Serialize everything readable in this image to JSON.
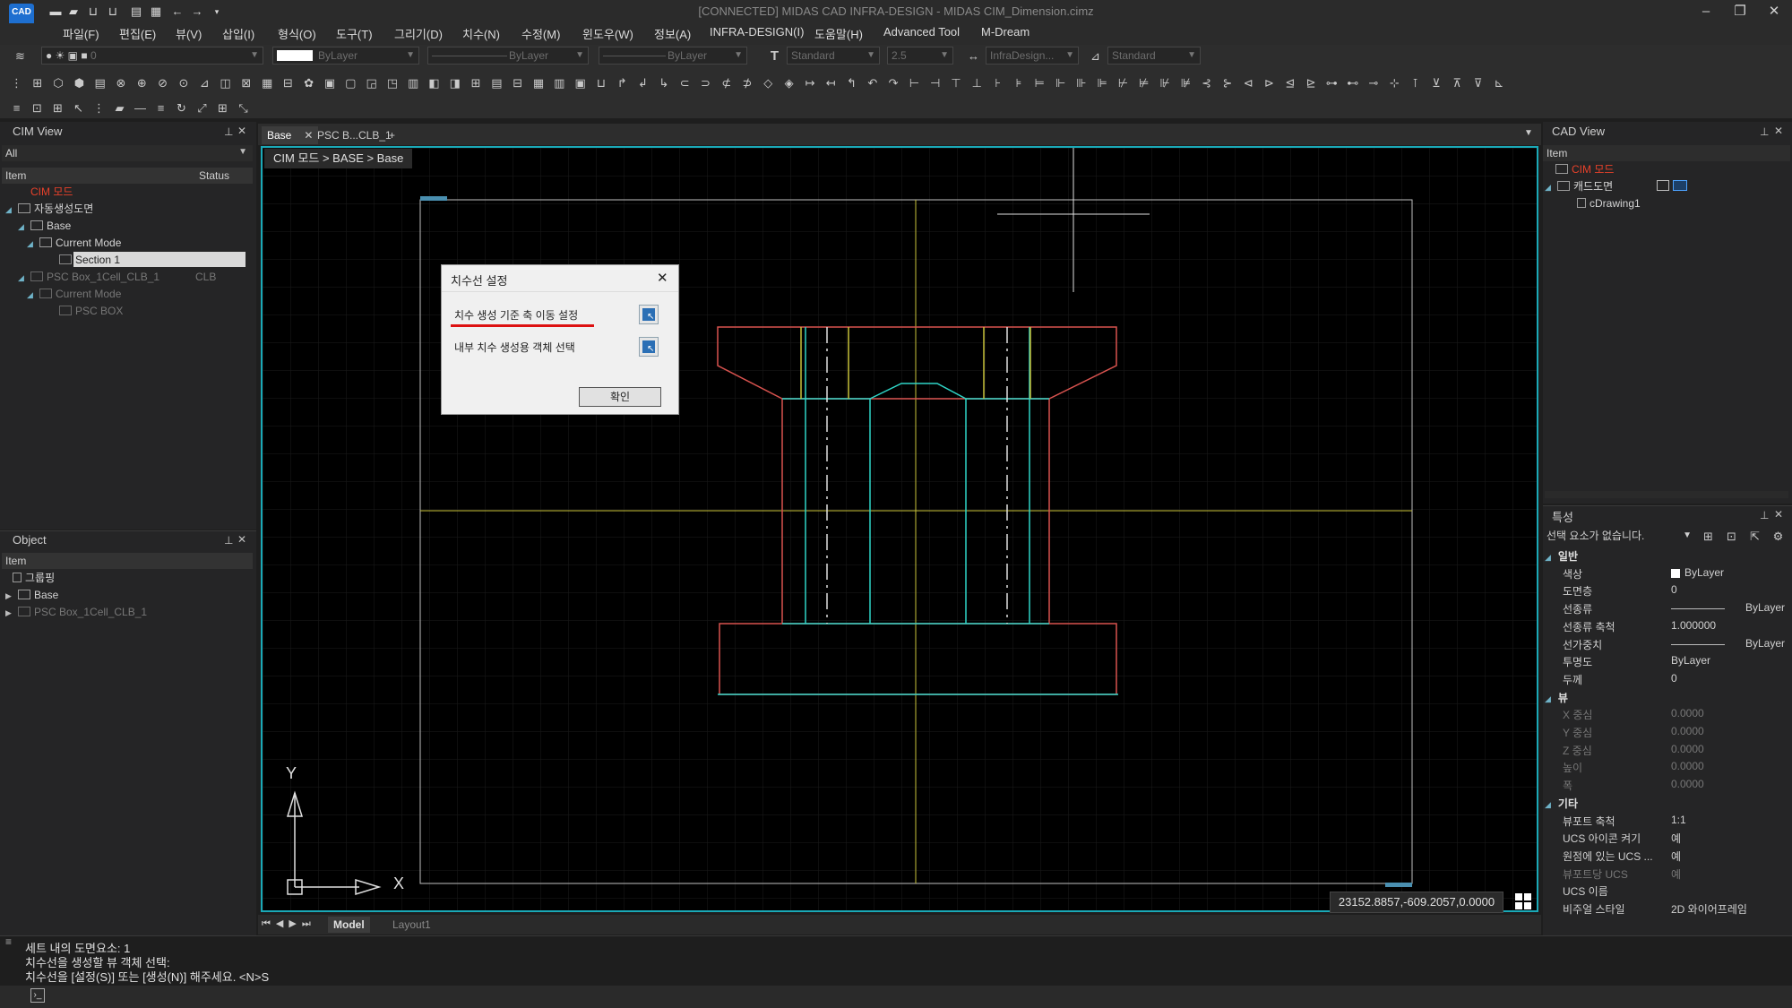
{
  "app": {
    "logo_text": "CAD",
    "title": "[CONNECTED] MIDAS CAD INFRA-DESIGN - MIDAS CIM_Dimension.cimz"
  },
  "menu": [
    "파일(F)",
    "편집(E)",
    "뷰(V)",
    "삽입(I)",
    "형식(O)",
    "도구(T)",
    "그리기(D)",
    "치수(N)",
    "수정(M)",
    "윈도우(W)",
    "정보(A)",
    "INFRA-DESIGN(I)",
    "도움말(H)",
    "Advanced Tool",
    "M-Dream"
  ],
  "toolbar": {
    "layer_value": "0",
    "color_value": "ByLayer",
    "linetype_value": "ByLayer",
    "lineweight_value": "ByLayer",
    "text_style": "Standard",
    "text_height": "2.5",
    "dim_style": "InfraDesign...",
    "table_style": "Standard"
  },
  "cim_view": {
    "title": "CIM View",
    "filter": "All",
    "col_item": "Item",
    "col_status": "Status",
    "tree": [
      {
        "label": "CIM 모드",
        "status": ""
      },
      {
        "label": "자동생성도면",
        "status": ""
      },
      {
        "label": "Base",
        "status": ""
      },
      {
        "label": "Current Mode",
        "status": ""
      },
      {
        "label": "Section 1",
        "status": ""
      },
      {
        "label": "PSC Box_1Cell_CLB_1",
        "status": "CLB"
      },
      {
        "label": "Current Mode",
        "status": ""
      },
      {
        "label": "PSC BOX",
        "status": ""
      }
    ]
  },
  "object_panel": {
    "title": "Object",
    "col_item": "Item",
    "tree": [
      "그룹핑",
      "Base",
      "PSC Box_1Cell_CLB_1"
    ]
  },
  "tabs": {
    "items": [
      "Base",
      "PSC B...CLB_1"
    ],
    "add": "+"
  },
  "breadcrumb": "CIM 모드 > BASE > Base",
  "dialog": {
    "title": "치수선 설정",
    "row1": "치수 생성 기준 축 이동 설정",
    "row2": "내부 치수 생성용 객체 선택",
    "ok": "확인"
  },
  "ucs": {
    "x": "X",
    "y": "Y"
  },
  "coords": "23152.8857,-609.2057,0.0000",
  "layout_tabs": [
    "Model",
    "Layout1"
  ],
  "cad_view": {
    "title": "CAD View",
    "col_item": "Item",
    "tree": [
      "CIM 모드",
      "캐드도면",
      "cDrawing1"
    ]
  },
  "properties": {
    "title": "특성",
    "selection": "선택 요소가 없습니다.",
    "groups": [
      {
        "name": "일반",
        "rows": [
          {
            "label": "색상",
            "value": "ByLayer"
          },
          {
            "label": "도면층",
            "value": "0"
          },
          {
            "label": "선종류",
            "value": "ByLayer"
          },
          {
            "label": "선종류 축척",
            "value": "1.000000"
          },
          {
            "label": "선가중치",
            "value": "ByLayer"
          },
          {
            "label": "투명도",
            "value": "ByLayer"
          },
          {
            "label": "두께",
            "value": "0"
          }
        ]
      },
      {
        "name": "뷰",
        "rows": [
          {
            "label": "X 중심",
            "value": "0.0000"
          },
          {
            "label": "Y 중심",
            "value": "0.0000"
          },
          {
            "label": "Z 중심",
            "value": "0.0000"
          },
          {
            "label": "높이",
            "value": "0.0000"
          },
          {
            "label": "폭",
            "value": "0.0000"
          }
        ]
      },
      {
        "name": "기타",
        "rows": [
          {
            "label": "뷰포트 축척",
            "value": "1:1"
          },
          {
            "label": "UCS 아이콘 켜기",
            "value": "예"
          },
          {
            "label": "원점에 있는 UCS ...",
            "value": "예"
          },
          {
            "label": "뷰포트당 UCS",
            "value": "예"
          },
          {
            "label": "UCS 이름",
            "value": ""
          },
          {
            "label": "비주얼 스타일",
            "value": "2D 와이어프레임"
          }
        ]
      }
    ]
  },
  "command": {
    "lines": [
      "세트 내의 도면요소: 1",
      "치수선을 생성할 뷰 객체 선택:",
      "치수선을 [설정(S)] 또는 [생성(N)] 해주세요. <N>S"
    ]
  },
  "colors": {
    "accent": "#1aa9b7",
    "cim_red": "#e8412a",
    "drawing_red": "#d9534f",
    "drawing_cyan": "#2fd6c8",
    "axis_yellow": "#c8c23a"
  }
}
